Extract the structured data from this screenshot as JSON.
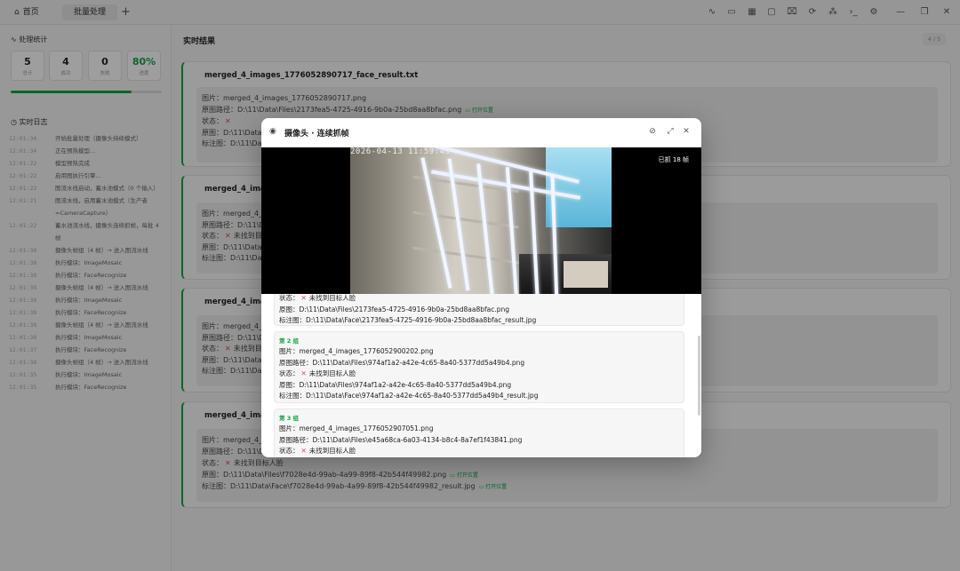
{
  "topbar": {
    "tabs": [
      {
        "label": "首页",
        "icon": "home-icon"
      },
      {
        "label": "批量处理"
      }
    ],
    "add": "+",
    "tools": [
      "activity-icon",
      "folder-icon",
      "grid-icon",
      "monitor-icon",
      "trash-icon",
      "refresh-icon",
      "nodes-icon",
      "terminal-icon",
      "gear-icon",
      "minimize-icon",
      "restore-icon",
      "close-icon"
    ]
  },
  "sidebar": {
    "stats_title": "处理统计",
    "stats": [
      {
        "value": "5",
        "label": "总计"
      },
      {
        "value": "4",
        "label": "成功"
      },
      {
        "value": "0",
        "label": "失败"
      },
      {
        "value": "80%",
        "label": "进度"
      }
    ],
    "progress": 0.8,
    "log_title": "实时日志",
    "log": [
      {
        "t": "12:01:34",
        "m": "开始批量处理（摄像头持续模式）"
      },
      {
        "t": "12:01:34",
        "m": "正在预热模型..."
      },
      {
        "t": "12:01:22",
        "m": "模型预热完成"
      },
      {
        "t": "12:01:22",
        "m": "启用图执行引擎..."
      },
      {
        "t": "12:01:22",
        "m": "图流水线启动，蓄水池模式（0 个输入）"
      },
      {
        "t": "12:01:21",
        "m": "图流水线，启用蓄水池模式（生产者=CameraCapture）"
      },
      {
        "t": "12:01:22",
        "m": "蓄水池流水线，摄像头连续抓帧，每批 4 帧"
      },
      {
        "t": "12:01:38",
        "m": "摄像头帧组（4 帧）→ 送入图流水线"
      },
      {
        "t": "12:01:38",
        "m": "执行模块：ImageMosaic"
      },
      {
        "t": "12:01:38",
        "m": "执行模块：FaceRecognize"
      },
      {
        "t": "12:01:39",
        "m": "摄像头帧组（4 帧）→ 送入图流水线"
      },
      {
        "t": "12:01:38",
        "m": "执行模块：ImageMosaic"
      },
      {
        "t": "12:01:38",
        "m": "执行模块：FaceRecognize"
      },
      {
        "t": "12:01:38",
        "m": "摄像头帧组（4 帧）→ 送入图流水线"
      },
      {
        "t": "12:01:38",
        "m": "执行模块：ImageMosaic"
      },
      {
        "t": "12:01:37",
        "m": "执行模块：FaceRecognize"
      },
      {
        "t": "12:01:38",
        "m": "摄像头帧组（4 帧）→ 送入图流水线"
      },
      {
        "t": "12:01:35",
        "m": "执行模块：ImageMosaic"
      },
      {
        "t": "12:01:35",
        "m": "执行模块：FaceRecognize"
      }
    ]
  },
  "main": {
    "title": "实时结果",
    "count": "4 / 5",
    "cards": [
      {
        "title": "merged_4_images_1776052890717_face_result.txt",
        "lines": [
          "图片：merged_4_images_1776052890717.png",
          "原图路径：D:\\11\\Data\\Files\\2173fea5-4725-4916-9b0a-25bd8aa8bfac.png",
          "状态：",
          "原图：D:\\11\\Data\\",
          "标注图：D:\\11\\Data\\"
        ],
        "link": "打开位置"
      },
      {
        "title": "merged_4_image",
        "lines": [
          "图片：merged_4_i",
          "原图路径：D:\\11\\D",
          "状态：未找到目",
          "原图：D:\\11\\Data",
          "标注图：D:\\11\\Dat"
        ]
      },
      {
        "title": "merged_4_image",
        "lines": [
          "图片：merged_4_i",
          "原图路径：D:\\11\\D",
          "状态：未找到目",
          "原图：D:\\11\\Data",
          "标注图：D:\\11\\Dat"
        ]
      },
      {
        "title": "merged_4_image",
        "lines": [
          "图片：merged_4_i",
          "原图路径：D:\\11\\Data\\Files\\f7028e4d-99ab-4a99-89f8-42b544f49982.png",
          "状态：未找到目标人脸",
          "原图：D:\\11\\Data\\Files\\f7028e4d-99ab-4a99-89f8-42b544f49982.png",
          "标注图：D:\\11\\Data\\Face\\f7028e4d-99ab-4a99-89f8-42b544f49982_result.jpg"
        ],
        "link": "打开位置"
      }
    ]
  },
  "modal": {
    "title": "摄像头 · 连续抓帧",
    "timestamp": "2026-04-13 11:59:49",
    "grabbed": "已抓 18 帧",
    "groups": [
      {
        "label": "",
        "lines": [
          "状态：未找到目标人脸",
          "原图：D:\\11\\Data\\Files\\2173fea5-4725-4916-9b0a-25bd8aa8bfac.png",
          "标注图：D:\\11\\Data\\Face\\2173fea5-4725-4916-9b0a-25bd8aa8bfac_result.jpg"
        ]
      },
      {
        "label": "第 2 组",
        "lines": [
          "图片：merged_4_images_1776052900202.png",
          "原图路径：D:\\11\\Data\\Files\\974af1a2-a42e-4c65-8a40-5377dd5a49b4.png",
          "状态：未找到目标人脸",
          "原图：D:\\11\\Data\\Files\\974af1a2-a42e-4c65-8a40-5377dd5a49b4.png",
          "标注图：D:\\11\\Data\\Face\\974af1a2-a42e-4c65-8a40-5377dd5a49b4_result.jpg"
        ]
      },
      {
        "label": "第 3 组",
        "lines": [
          "图片：merged_4_images_1776052907051.png",
          "原图路径：D:\\11\\Data\\Files\\e45a68ca-6a03-4134-b8c4-8a7ef1f43841.png",
          "状态：未找到目标人脸"
        ]
      }
    ]
  }
}
